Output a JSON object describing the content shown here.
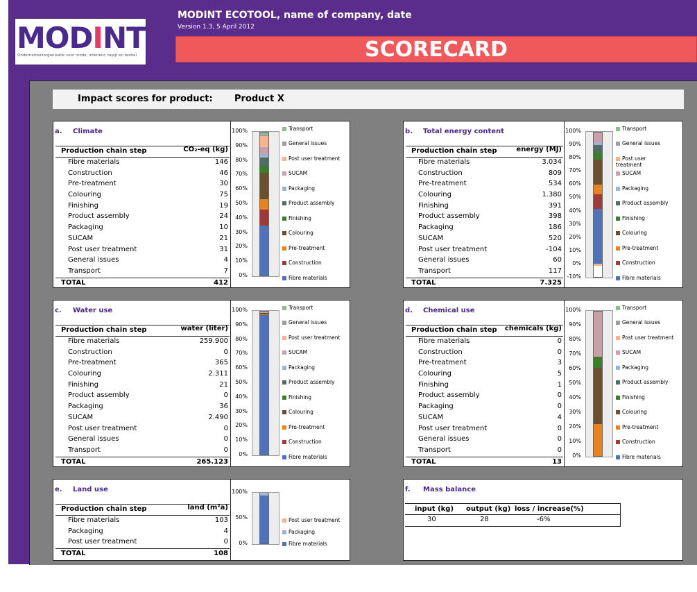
{
  "header": {
    "logo_text_1": "MOD",
    "logo_text_i": "I",
    "logo_text_2": "NT",
    "logo_subtitle": "Ondernemersorganisatie voor mode, interieur, tapijt en textiel",
    "app_title": "MODINT ECOTOOL, name of company, date",
    "version": "Version 1.3, 5 April 2012",
    "banner": "SCORECARD"
  },
  "impact": {
    "label": "Impact scores for product:",
    "product": "Product X"
  },
  "colors": {
    "Transport": "#8fbc8f",
    "General issues": "#9e9e9e",
    "Post user treatment": "#f7b38d",
    "SUCAM": "#c9a0a8",
    "Packaging": "#9eb3d8",
    "Product assembly": "#4f6d60",
    "Finishing": "#3c7d2c",
    "Colouring": "#6b4f2f",
    "Pre-treatment": "#e8821e",
    "Construction": "#9e3a3a",
    "Fibre materials": "#4e73b8"
  },
  "panels": [
    {
      "letter": "a.",
      "title": "Climate",
      "col_step": "Production chain step",
      "col_unit": "CO₂-eq (kg)",
      "rows": [
        {
          "step": "Fibre materials",
          "value": "146"
        },
        {
          "step": "Construction",
          "value": "46"
        },
        {
          "step": "Pre-treatment",
          "value": "30"
        },
        {
          "step": "Colouring",
          "value": "75"
        },
        {
          "step": "Finishing",
          "value": "19"
        },
        {
          "step": "Product assembly",
          "value": "24"
        },
        {
          "step": "Packaging",
          "value": "10"
        },
        {
          "step": "SUCAM",
          "value": "21"
        },
        {
          "step": "Post user treatment",
          "value": "31"
        },
        {
          "step": "General issues",
          "value": "4"
        },
        {
          "step": "Transport",
          "value": "7"
        }
      ],
      "total_label": "TOTAL",
      "total": "412",
      "yticks": [
        "100%",
        "90%",
        "80%",
        "70%",
        "60%",
        "50%",
        "40%",
        "30%",
        "20%",
        "10%",
        "0%"
      ],
      "legend": [
        "Transport",
        "General issues",
        "Post user treatment",
        "SUCAM",
        "Packaging",
        "Product assembly",
        "Finishing",
        "Colouring",
        "Pre-treatment",
        "Construction",
        "Fibre materials"
      ]
    },
    {
      "letter": "b.",
      "title": "Total energy content",
      "col_step": "Production chain step",
      "col_unit": "energy (MJ)",
      "rows": [
        {
          "step": "Fibre materials",
          "value": "3.034"
        },
        {
          "step": "Construction",
          "value": "809"
        },
        {
          "step": "Pre-treatment",
          "value": "534"
        },
        {
          "step": "Colouring",
          "value": "1.380"
        },
        {
          "step": "Finishing",
          "value": "391"
        },
        {
          "step": "Product assembly",
          "value": "398"
        },
        {
          "step": "Packaging",
          "value": "186"
        },
        {
          "step": "SUCAM",
          "value": "520"
        },
        {
          "step": "Post user treatment",
          "value": "-104"
        },
        {
          "step": "General issues",
          "value": "60"
        },
        {
          "step": "Transport",
          "value": "117"
        }
      ],
      "total_label": "TOTAL",
      "total": "7.325",
      "yticks": [
        "100%",
        "90%",
        "80%",
        "70%",
        "60%",
        "50%",
        "40%",
        "30%",
        "20%",
        "10%",
        "0%",
        "-10%"
      ],
      "legend": [
        "Transport",
        "General issues",
        "Post user\ntreatment",
        "SUCAM",
        "Packaging",
        "Product assembly",
        "Finishing",
        "Colouring",
        "Pre-treatment",
        "Construction",
        "Fibre materials"
      ]
    },
    {
      "letter": "c.",
      "title": "Water use",
      "col_step": "Production chain step",
      "col_unit": "water (liter)",
      "rows": [
        {
          "step": "Fibre materials",
          "value": "259.900"
        },
        {
          "step": "Construction",
          "value": "0"
        },
        {
          "step": "Pre-treatment",
          "value": "365"
        },
        {
          "step": "Colouring",
          "value": "2.311"
        },
        {
          "step": "Finishing",
          "value": "21"
        },
        {
          "step": "Product assembly",
          "value": "0"
        },
        {
          "step": "Packaging",
          "value": "36"
        },
        {
          "step": "SUCAM",
          "value": "2.490"
        },
        {
          "step": "Post user treatment",
          "value": "0"
        },
        {
          "step": "General issues",
          "value": "0"
        },
        {
          "step": "Transport",
          "value": "0"
        }
      ],
      "total_label": "TOTAL",
      "total": "265.123",
      "yticks": [
        "100%",
        "90%",
        "80%",
        "70%",
        "60%",
        "50%",
        "40%",
        "30%",
        "20%",
        "10%",
        "0%"
      ],
      "legend": [
        "Transport",
        "General issues",
        "Post user treatment",
        "SUCAM",
        "Packaging",
        "Product assembly",
        "Finishing",
        "Colouring",
        "Pre-treatment",
        "Construction",
        "Fibre materials"
      ]
    },
    {
      "letter": "d.",
      "title": "Chemical use",
      "col_step": "Production chain step",
      "col_unit": "chemicals (kg)",
      "rows": [
        {
          "step": "Fibre materials",
          "value": "0"
        },
        {
          "step": "Construction",
          "value": "0"
        },
        {
          "step": "Pre-treatment",
          "value": "3"
        },
        {
          "step": "Colouring",
          "value": "5"
        },
        {
          "step": "Finishing",
          "value": "1"
        },
        {
          "step": "Product assembly",
          "value": "0"
        },
        {
          "step": "Packaging",
          "value": "0"
        },
        {
          "step": "SUCAM",
          "value": "4"
        },
        {
          "step": "Post user treatment",
          "value": "0"
        },
        {
          "step": "General issues",
          "value": "0"
        },
        {
          "step": "Transport",
          "value": "0"
        }
      ],
      "total_label": "TOTAL",
      "total": "13",
      "yticks": [
        "100%",
        "90%",
        "80%",
        "70%",
        "60%",
        "50%",
        "40%",
        "30%",
        "20%",
        "10%",
        "0%"
      ],
      "legend": [
        "Transport",
        "General issues",
        "Post user treatment",
        "SUCAM",
        "Packaging",
        "Product assembly",
        "Finishing",
        "Colouring",
        "Pre-treatment",
        "Construction",
        "Fibre materials"
      ]
    },
    {
      "letter": "e.",
      "title": "Land use",
      "col_step": "Production chain step",
      "col_unit": "land (m²a)",
      "rows": [
        {
          "step": "Fibre materials",
          "value": "103"
        },
        {
          "step": "Packaging",
          "value": "4"
        },
        {
          "step": "Post user treatment",
          "value": "0"
        }
      ],
      "total_label": "TOTAL",
      "total": "108",
      "yticks": [
        "100%",
        "50%",
        "0%"
      ],
      "legend": [
        "Post user treatment",
        "Packaging",
        "Fibre materials"
      ]
    }
  ],
  "mass_balance": {
    "letter": "f.",
    "title": "Mass balance",
    "headers": [
      "input (kg)",
      "output (kg)",
      "loss / increase(%)"
    ],
    "values": [
      "30",
      "28",
      "-6%"
    ]
  }
}
